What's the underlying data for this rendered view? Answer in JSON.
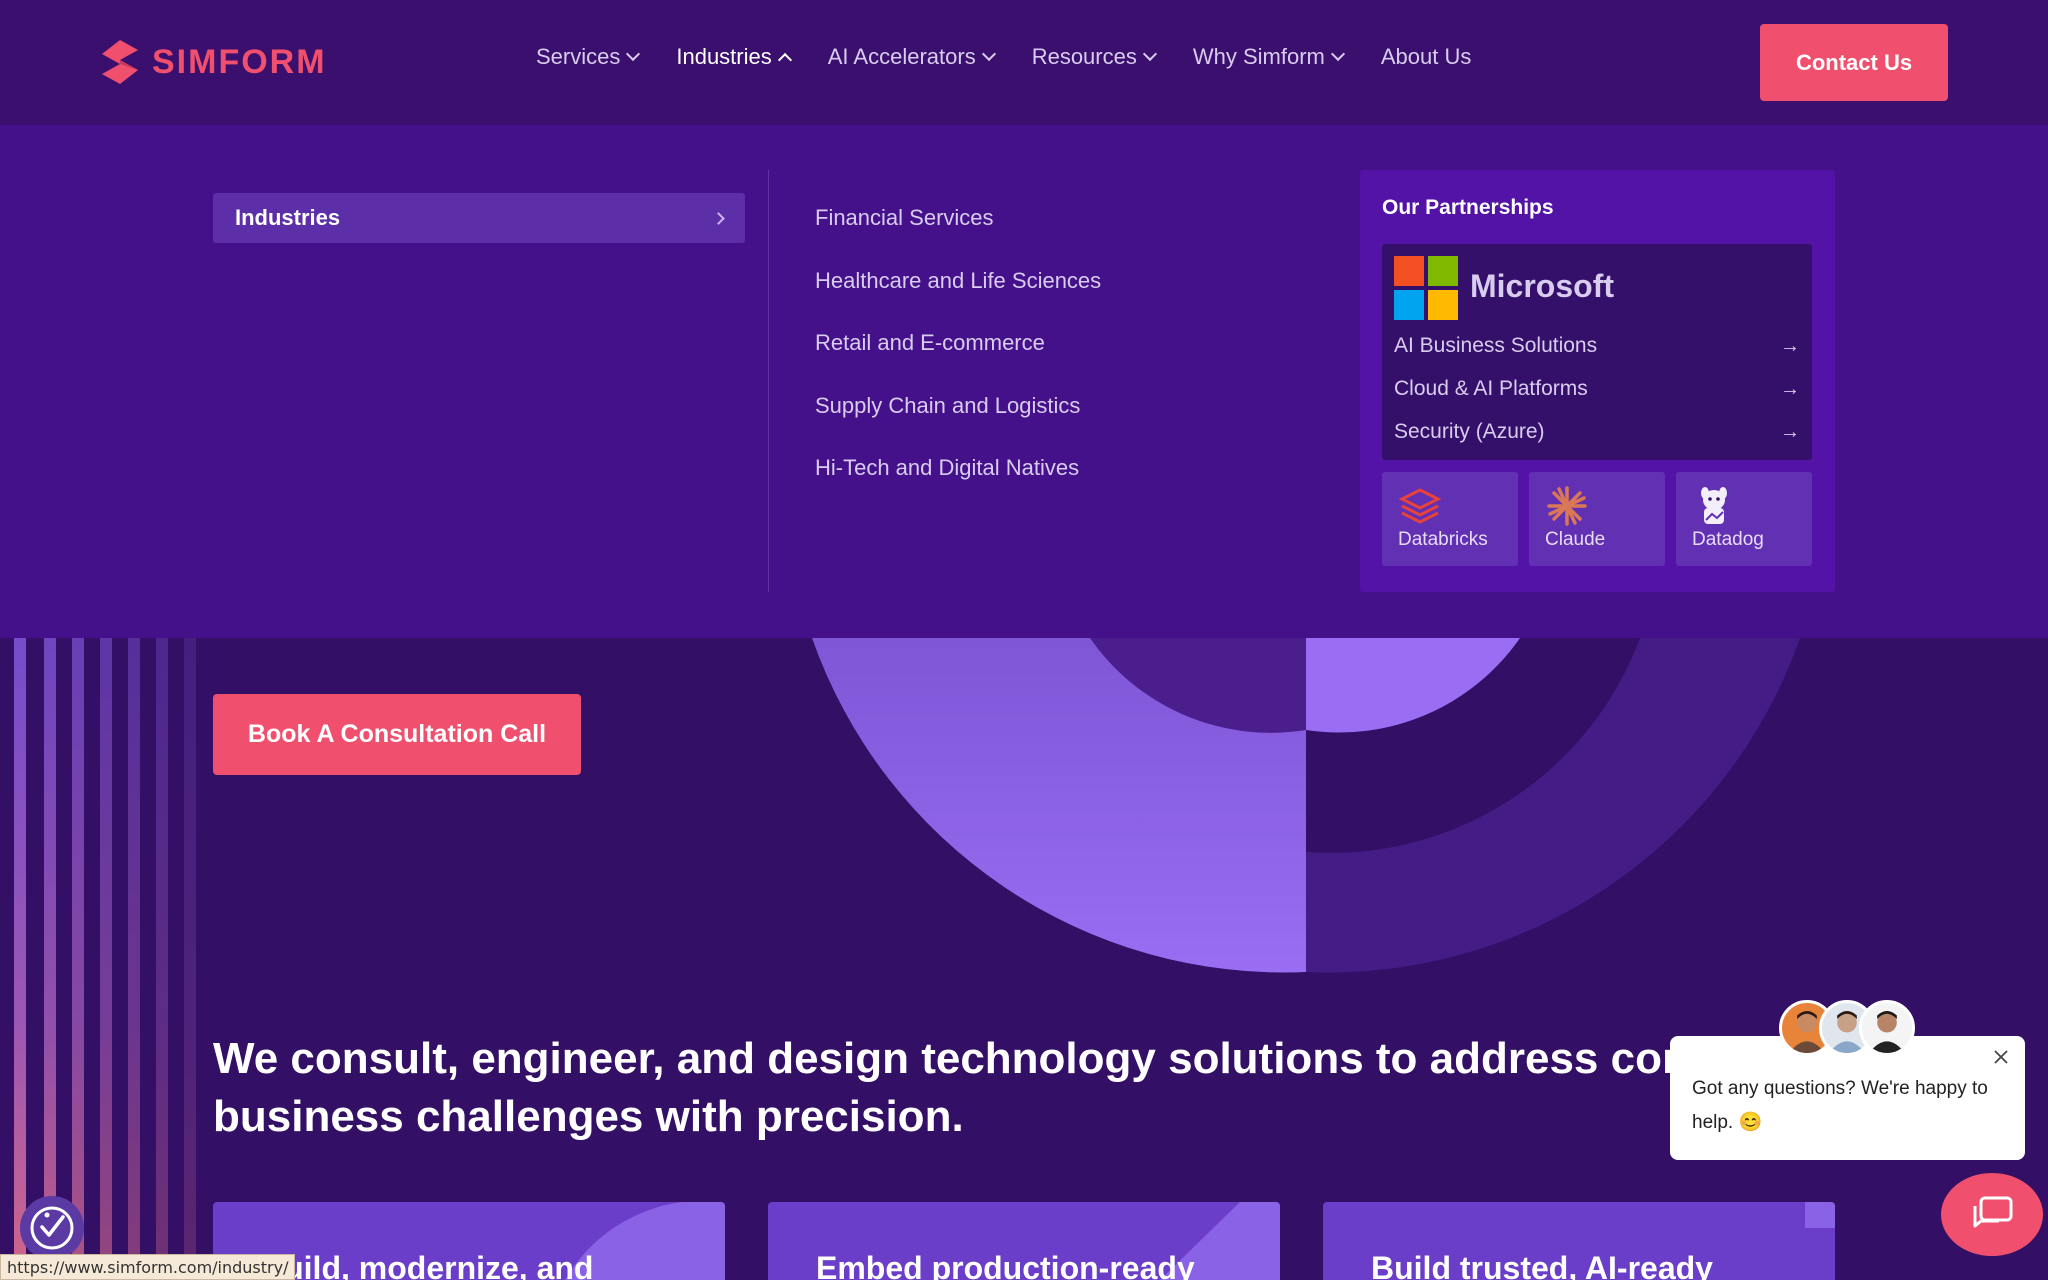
{
  "brand": {
    "name": "SIMFORM",
    "accent": "#f0506e"
  },
  "nav": {
    "items": [
      {
        "label": "Services",
        "icon": "chevron-down-icon"
      },
      {
        "label": "Industries",
        "icon": "chevron-up-icon",
        "active": true
      },
      {
        "label": "AI Accelerators",
        "icon": "chevron-down-icon"
      },
      {
        "label": "Resources",
        "icon": "chevron-down-icon"
      },
      {
        "label": "Why Simform",
        "icon": "chevron-down-icon"
      },
      {
        "label": "About Us"
      }
    ],
    "contact_label": "Contact Us"
  },
  "mega_menu": {
    "left_item": "Industries",
    "industries": [
      "Financial Services",
      "Healthcare and Life Sciences",
      "Retail and E-commerce",
      "Supply Chain and Logistics",
      "Hi-Tech and Digital Natives"
    ],
    "partnerships": {
      "title": "Our Partnerships",
      "microsoft": {
        "name": "Microsoft",
        "links": [
          "AI Business Solutions",
          "Cloud & AI Platforms",
          "Security (Azure)"
        ],
        "link_arrow": "→"
      },
      "tiles": [
        {
          "label": "Databricks",
          "icon": "databricks-icon"
        },
        {
          "label": "Claude",
          "icon": "claude-icon"
        },
        {
          "label": "Datadog",
          "icon": "datadog-icon"
        }
      ]
    }
  },
  "hero": {
    "cta_label": "Book A Consultation Call",
    "line1": "We consult, engineer, and design technology solutions to address complex",
    "line2": "business challenges with precision."
  },
  "cards": [
    "Build, modernize, and",
    "Embed production-ready",
    "Build trusted, AI-ready"
  ],
  "chat": {
    "message": "Got any questions? We're happy to help. 😊"
  },
  "status_url": "https://www.simform.com/industry/"
}
